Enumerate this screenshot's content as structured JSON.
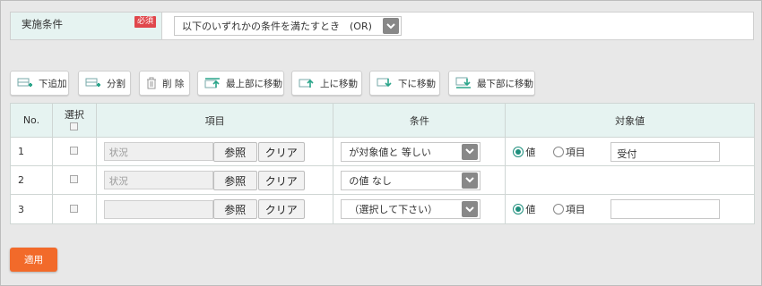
{
  "condition": {
    "label": "実施条件",
    "required_badge": "必須",
    "select_value": "以下のいずれかの条件を満たすとき　(OR)"
  },
  "toolbar": {
    "buttons": [
      {
        "label": "下追加",
        "icon": "row-add-below-icon"
      },
      {
        "label": "分割",
        "icon": "row-split-icon"
      },
      {
        "label": "削 除",
        "icon": "trash-icon"
      },
      {
        "label": "最上部に移動",
        "icon": "move-top-icon"
      },
      {
        "label": "上に移動",
        "icon": "move-up-icon"
      },
      {
        "label": "下に移動",
        "icon": "move-down-icon"
      },
      {
        "label": "最下部に移動",
        "icon": "move-bottom-icon"
      }
    ]
  },
  "table": {
    "headers": {
      "no": "No.",
      "select": "選択",
      "item": "項目",
      "condition": "条件",
      "target": "対象値"
    },
    "ref_button": "参照",
    "clear_button": "クリア",
    "radio_value_label": "値",
    "radio_item_label": "項目",
    "rows": [
      {
        "no": "1",
        "item_value": "状況",
        "condition": "が対象値と 等しい",
        "target_value": "受付"
      },
      {
        "no": "2",
        "item_value": "状況",
        "condition": "の値 なし"
      },
      {
        "no": "3",
        "item_value": "",
        "condition": "（選択して下さい）",
        "target_value": ""
      }
    ]
  },
  "apply_button": "適用",
  "colors": {
    "header_bg": "#e6f3f1",
    "badge": "#e0474c",
    "apply": "#f26a2a",
    "radio_on": "#1f8f7d",
    "icon_green": "#2aa58a"
  }
}
